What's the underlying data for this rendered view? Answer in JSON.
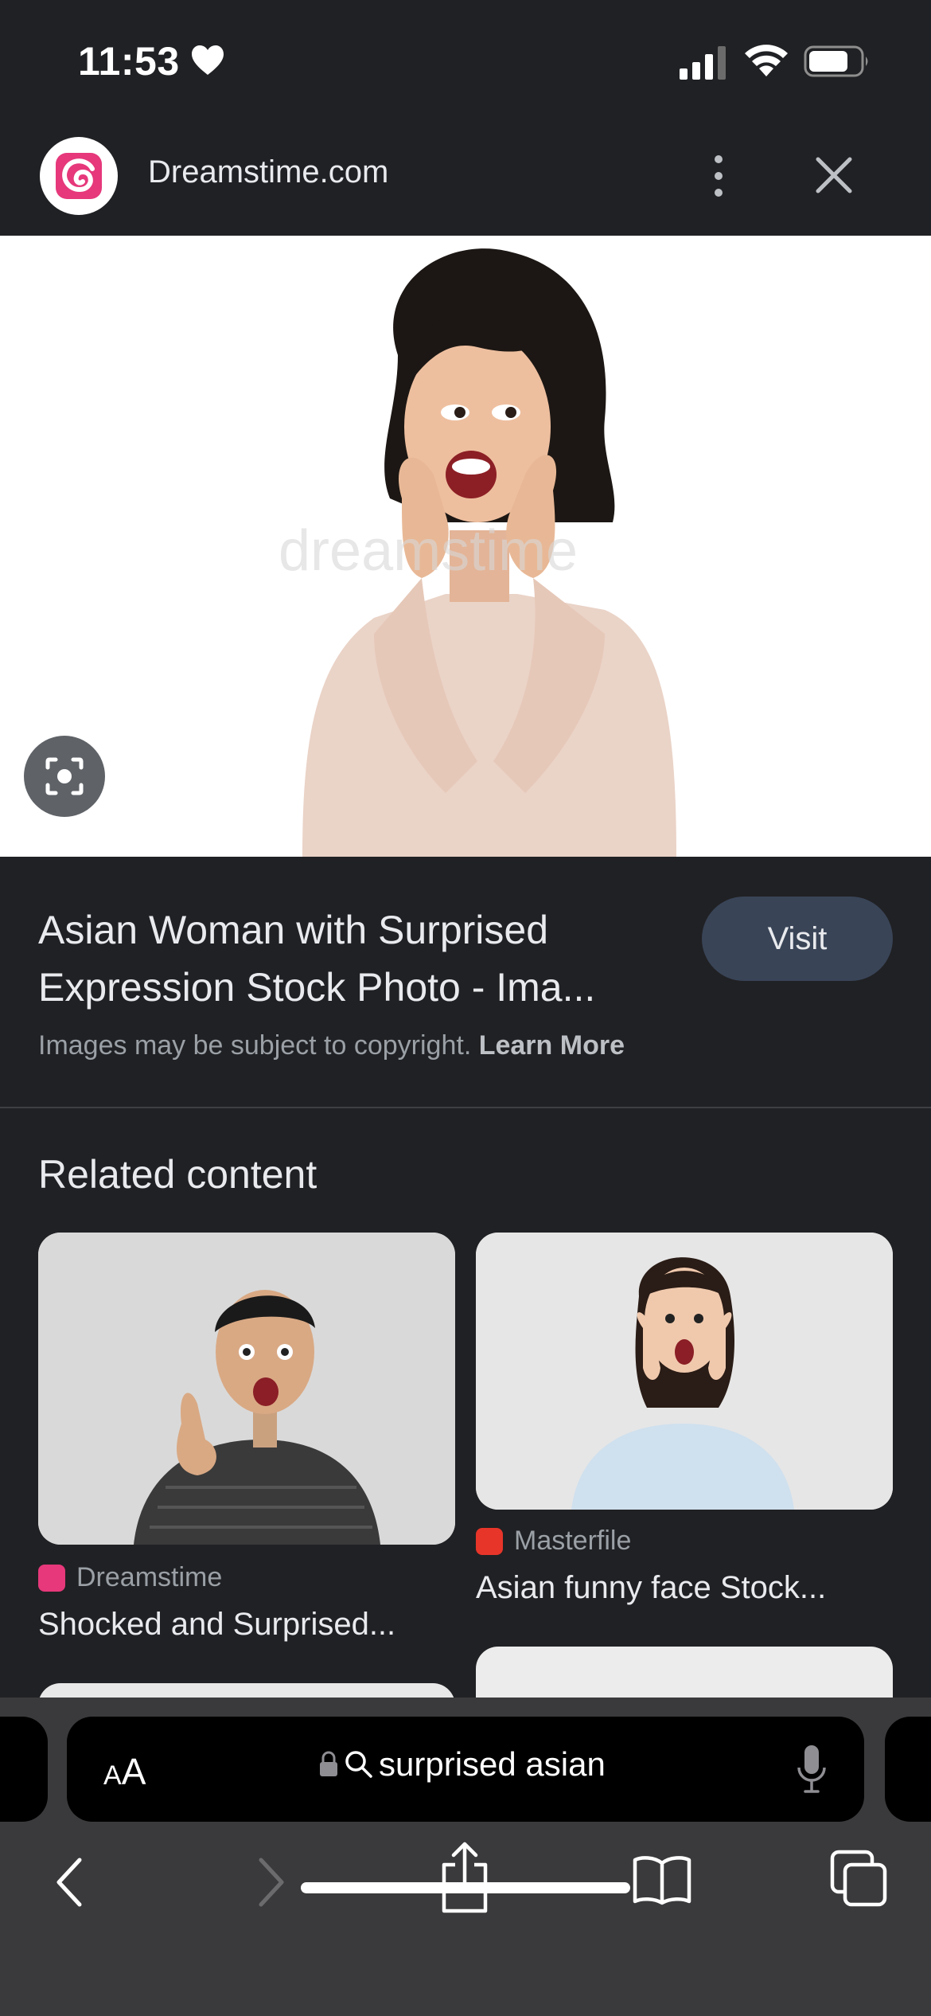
{
  "status_bar": {
    "time": "11:53"
  },
  "header": {
    "site_name": "Dreamstime.com"
  },
  "result": {
    "title": "Asian Woman with Surprised Expression Stock Photo - Ima...",
    "visit_label": "Visit",
    "copyright_text": "Images may be subject to copyright.",
    "learn_more": "Learn More"
  },
  "related": {
    "heading": "Related content",
    "cards": [
      {
        "source": "Dreamstime",
        "title": "Shocked and Surprised..."
      },
      {
        "source": "Masterfile",
        "title": "Asian funny face Stock..."
      }
    ]
  },
  "address_bar": {
    "aa_small": "A",
    "aa_big": "A",
    "query": "surprised asian"
  },
  "colors": {
    "background": "#202124",
    "visit_button": "#394457",
    "dreamstime_brand": "#e6387b",
    "masterfile_brand": "#e8352a"
  },
  "icons": [
    "heart-icon",
    "cellular-signal-icon",
    "wifi-icon",
    "battery-icon",
    "dreamstime-logo",
    "more-vertical-icon",
    "close-icon",
    "lens-icon",
    "lock-icon",
    "search-icon",
    "microphone-icon",
    "back-icon",
    "forward-icon",
    "share-icon",
    "bookmarks-icon",
    "tabs-icon"
  ]
}
